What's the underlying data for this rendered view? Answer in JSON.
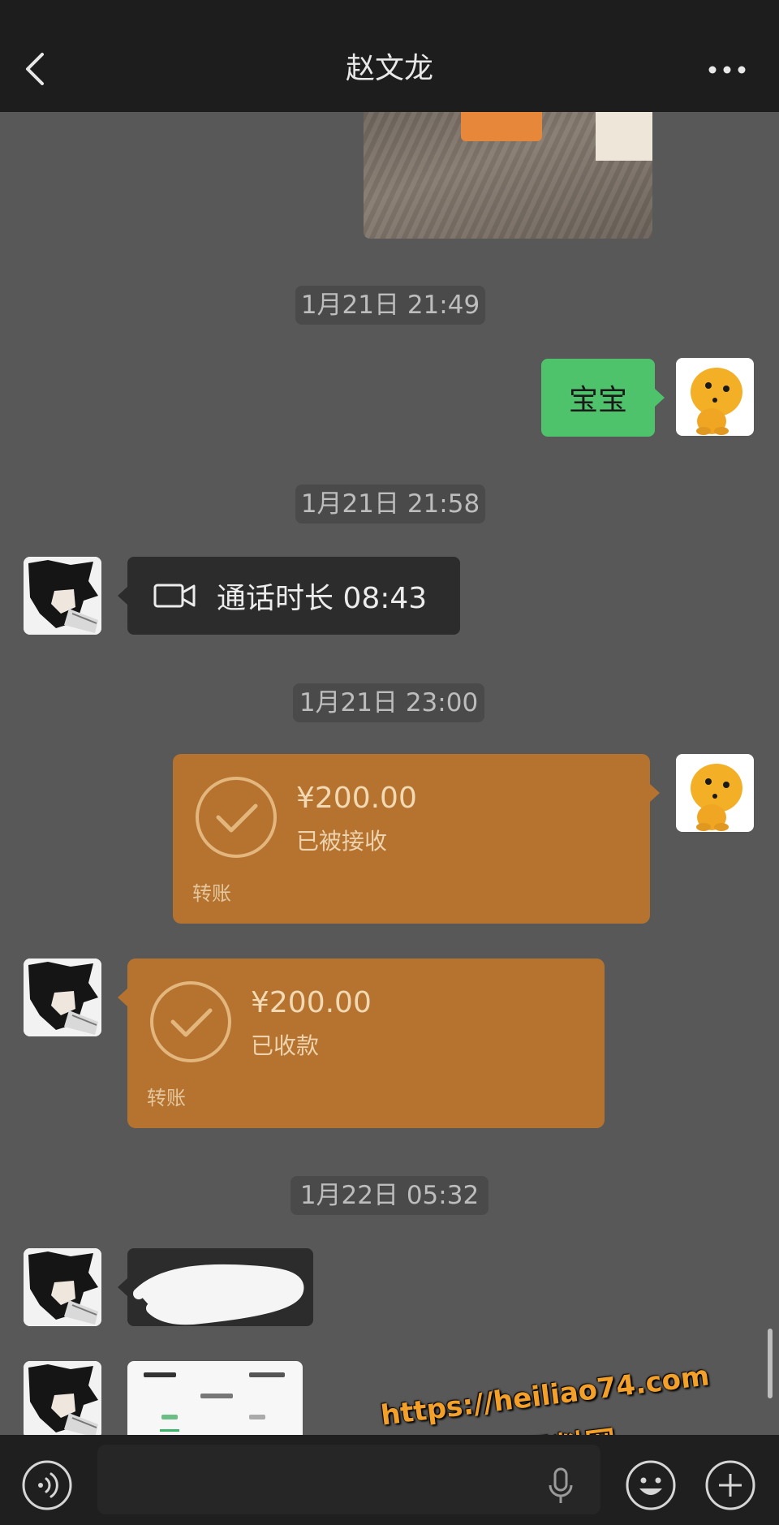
{
  "header": {
    "title": "赵文龙"
  },
  "messages": {
    "ts1": "1月21日 21:49",
    "sent_text": "宝宝",
    "ts2": "1月21日 21:58",
    "call_text": "通话时长 08:43",
    "ts3": "1月21日 23:00",
    "transfer_sent": {
      "amount": "¥200.00",
      "status": "已被接收",
      "label": "转账"
    },
    "transfer_received": {
      "amount": "¥200.00",
      "status": "已收款",
      "label": "转账"
    },
    "ts4": "1月22日 05:32"
  },
  "watermark": {
    "url": "https://heiliao74.com",
    "name": "黑料网"
  },
  "colors": {
    "chat_bg": "#585858",
    "bar_bg": "#1d1d1d",
    "sent_bubble": "#4ec36b",
    "recv_bubble": "#2c2c2c",
    "transfer_card": "#b5732f",
    "watermark": "#f3a02a"
  },
  "icons": [
    "back-arrow-icon",
    "more-dots-icon",
    "video-call-icon",
    "check-circle-icon",
    "voice-toggle-icon",
    "mic-icon",
    "emoji-icon",
    "plus-icon"
  ]
}
